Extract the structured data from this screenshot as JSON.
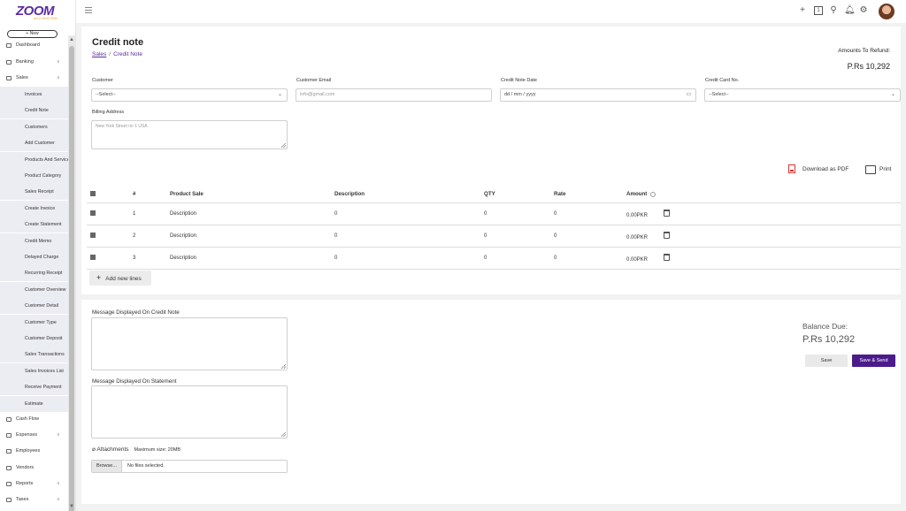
{
  "brand": {
    "name": "ZOOM",
    "tagline": "ACCOUNTING"
  },
  "new_button": "+ New",
  "nav": [
    {
      "label": "Dashboard",
      "icon": "dashboard-icon"
    },
    {
      "label": "Banking",
      "icon": "bank-icon",
      "chev": "∨"
    },
    {
      "label": "Sales",
      "icon": "chart-icon",
      "chev": "∧"
    }
  ],
  "sales_sub": [
    "Invoices",
    "Credit Note",
    "Customers",
    "Add Customer",
    "Products And Services",
    "Product Category",
    "Sales Receipt",
    "Create Invoice",
    "Create Statement",
    "Credit Memo",
    "Delayed Charge",
    "Recurring Receipt",
    "Customer Overview",
    "Customer Detail",
    "Customer Type",
    "Customer Deposit",
    "Sales Transactions",
    "Sales Invoices List",
    "Receive Payment",
    "Estimate"
  ],
  "nav_bottom": [
    {
      "label": "Cash Flow",
      "icon": "cash-icon"
    },
    {
      "label": "Expenses",
      "icon": "cart-icon",
      "chev": "∨"
    },
    {
      "label": "Employees",
      "icon": "user-icon"
    },
    {
      "label": "Vendors",
      "icon": "user-icon"
    },
    {
      "label": "Reports",
      "icon": "gear-icon",
      "chev": "∨"
    },
    {
      "label": "Taxes",
      "icon": "doc-icon",
      "chev": "∨"
    }
  ],
  "page": {
    "title": "Credit note",
    "crumb_root": "Sales",
    "crumb_sep": "/",
    "crumb_current": "Credit Note",
    "refund_label": "Amounts To Refund:",
    "refund_value": "P.Rs 10,292"
  },
  "form": {
    "customer_label": "Customer",
    "customer_value": "--Select--",
    "email_label": "Customer Email",
    "email_placeholder": "info@gmail.com",
    "date_label": "Credit Note Date",
    "date_placeholder": "dd / mm / yyyy",
    "card_label": "Credit Card No.",
    "card_value": "--Select--",
    "billing_label": "Billing Address",
    "billing_placeholder": "New York Street no 1 USA"
  },
  "tools": {
    "pdf": "Download as PDF",
    "print": "Print"
  },
  "table": {
    "headers": [
      "#",
      "Product Sale",
      "Description",
      "QTY",
      "Rate",
      "Amount"
    ],
    "rows": [
      {
        "n": "1",
        "product": "Description",
        "desc": "0",
        "qty": "0",
        "rate": "0",
        "amount": "0.00PKR"
      },
      {
        "n": "2",
        "product": "Description",
        "desc": "0",
        "qty": "0",
        "rate": "0",
        "amount": "0.00PKR"
      },
      {
        "n": "3",
        "product": "Description",
        "desc": "0",
        "qty": "0",
        "rate": "0",
        "amount": "0.00PKR"
      }
    ],
    "add_lines": "Add new lines"
  },
  "messages": {
    "credit_label": "Message Displayed On Credit Note",
    "statement_label": "Message Displayed On Statement"
  },
  "balance": {
    "label": "Balance Due:",
    "value": "P.Rs 10,292"
  },
  "buttons": {
    "save": "Save",
    "save_send": "Save & Send"
  },
  "attachments": {
    "label": "Attachments",
    "max": "Maximum size: 20MB",
    "browse": "Browse...",
    "status": "No files selected."
  }
}
